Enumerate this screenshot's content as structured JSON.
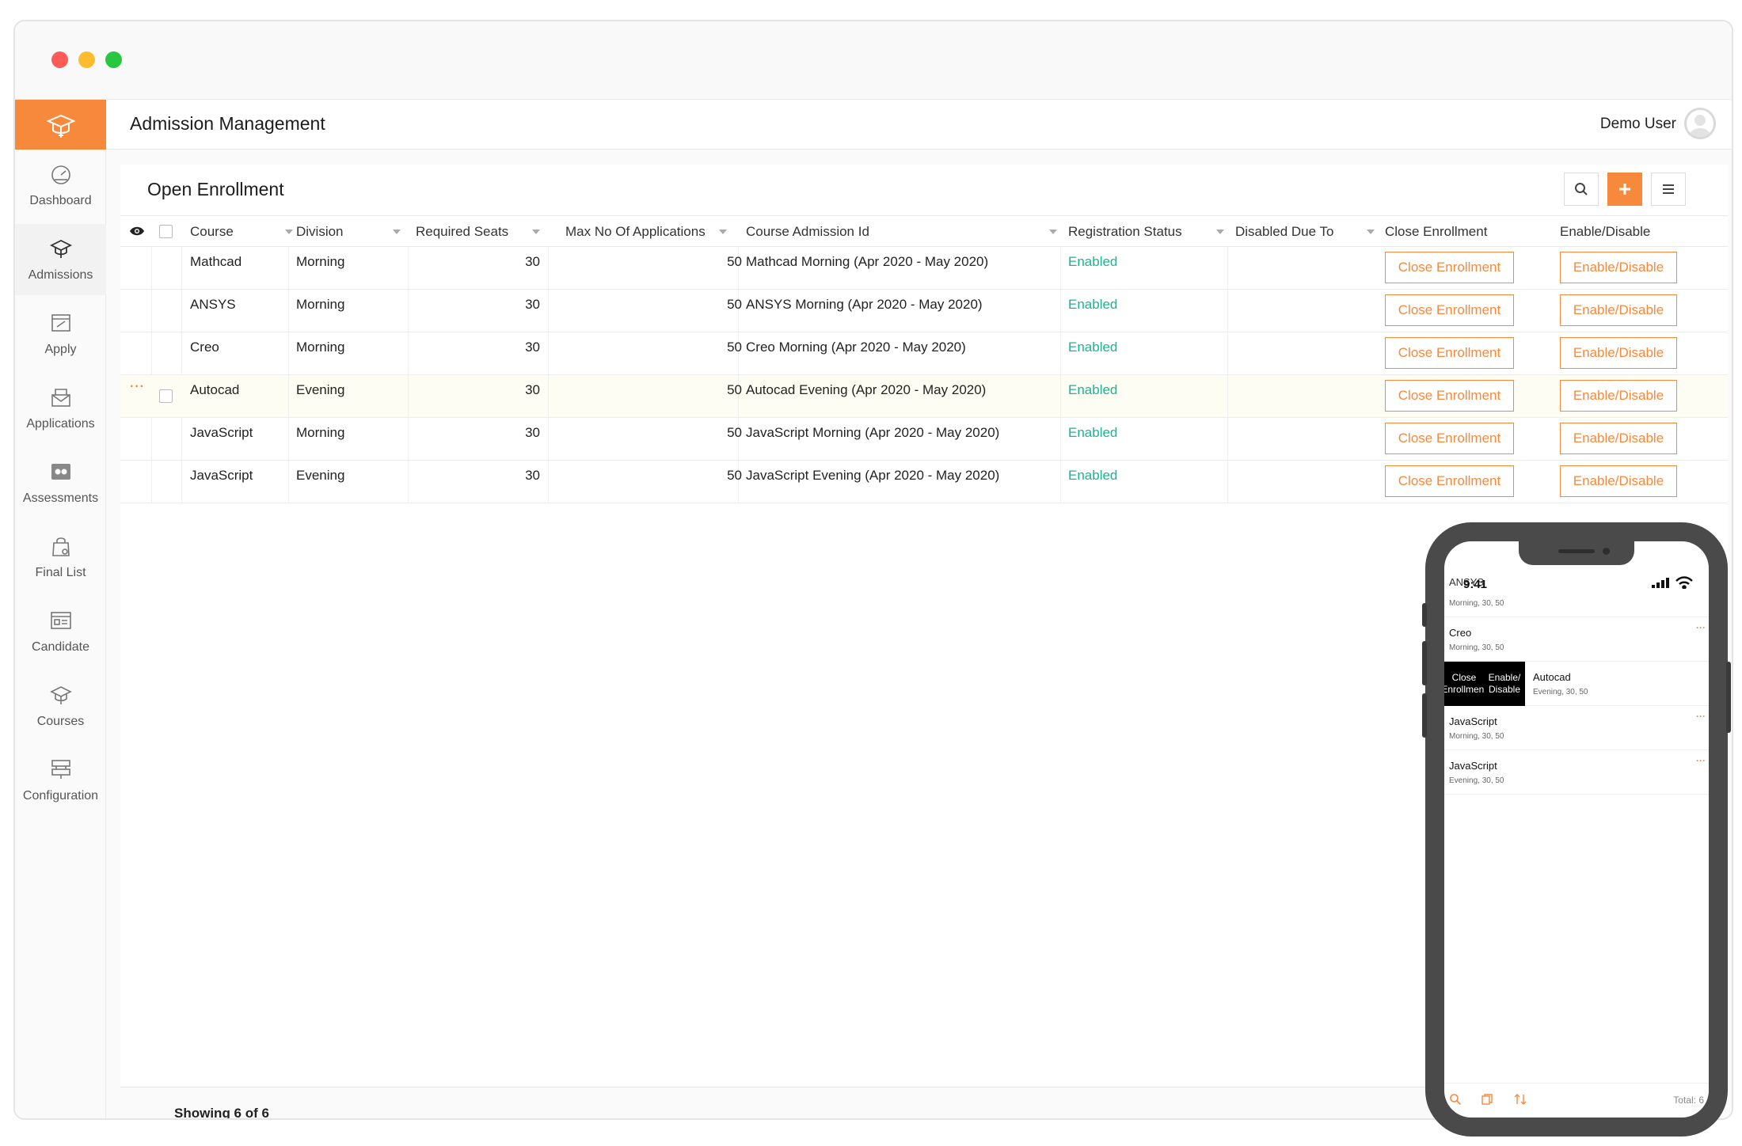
{
  "app": {
    "title": "Admission Management",
    "user_name": "Demo User",
    "accent_color": "#f7893c",
    "status_color": "#1ab394"
  },
  "sidebar": {
    "items": [
      {
        "label": "Dashboard",
        "icon": "speedometer-icon",
        "active": false
      },
      {
        "label": "Admissions",
        "icon": "graduation-cap-icon",
        "active": true
      },
      {
        "label": "Apply",
        "icon": "edit-form-icon",
        "active": false
      },
      {
        "label": "Applications",
        "icon": "mail-stack-icon",
        "active": false
      },
      {
        "label": "Assessments",
        "icon": "assessment-icon",
        "active": false
      },
      {
        "label": "Final List",
        "icon": "shopping-bag-icon",
        "active": false
      },
      {
        "label": "Candidate",
        "icon": "id-card-icon",
        "active": false
      },
      {
        "label": "Courses",
        "icon": "course-cap-icon",
        "active": false
      },
      {
        "label": "Configuration",
        "icon": "config-icon",
        "active": false
      }
    ]
  },
  "panel": {
    "title": "Open Enrollment",
    "toolbar": {
      "search_icon": "search-icon",
      "add_icon": "plus-icon",
      "menu_icon": "menu-icon"
    }
  },
  "table": {
    "columns": [
      "Course",
      "Division",
      "Required Seats",
      "Max No Of Applications",
      "Course Admission Id",
      "Registration Status",
      "Disabled Due To",
      "Close Enrollment",
      "Enable/Disable"
    ],
    "rows": [
      {
        "course": "Mathcad",
        "division": "Morning",
        "seats": "30",
        "max_apps": "50",
        "admission_id": "Mathcad Morning (Apr 2020 - May 2020)",
        "status": "Enabled",
        "disabled_due": "",
        "close_label": "Close Enrollment",
        "toggle_label": "Enable/Disable"
      },
      {
        "course": "ANSYS",
        "division": "Morning",
        "seats": "30",
        "max_apps": "50",
        "admission_id": "ANSYS Morning (Apr 2020 - May 2020)",
        "status": "Enabled",
        "disabled_due": "",
        "close_label": "Close Enrollment",
        "toggle_label": "Enable/Disable"
      },
      {
        "course": "Creo",
        "division": "Morning",
        "seats": "30",
        "max_apps": "50",
        "admission_id": "Creo Morning (Apr 2020 - May 2020)",
        "status": "Enabled",
        "disabled_due": "",
        "close_label": "Close Enrollment",
        "toggle_label": "Enable/Disable"
      },
      {
        "course": "Autocad",
        "division": "Evening",
        "seats": "30",
        "max_apps": "50",
        "admission_id": "Autocad Evening (Apr 2020 - May 2020)",
        "status": "Enabled",
        "disabled_due": "",
        "close_label": "Close Enrollment",
        "toggle_label": "Enable/Disable",
        "dots": "···"
      },
      {
        "course": "JavaScript",
        "division": "Morning",
        "seats": "30",
        "max_apps": "50",
        "admission_id": "JavaScript Morning (Apr 2020 - May 2020)",
        "status": "Enabled",
        "disabled_due": "",
        "close_label": "Close Enrollment",
        "toggle_label": "Enable/Disable"
      },
      {
        "course": "JavaScript",
        "division": "Evening",
        "seats": "30",
        "max_apps": "50",
        "admission_id": "JavaScript Evening (Apr 2020 - May 2020)",
        "status": "Enabled",
        "disabled_due": "",
        "close_label": "Close Enrollment",
        "toggle_label": "Enable/Disable"
      }
    ],
    "footer": "Showing 6 of 6"
  },
  "phone": {
    "time": "9:41",
    "peek_text": "ANSYS",
    "items": [
      {
        "name": "ANSYS",
        "sub": "Morning, 30, 50"
      },
      {
        "name": "Creo",
        "sub": "Morning, 30, 50",
        "dots": "···"
      },
      {
        "name": "Autocad",
        "sub": "Evening, 30, 50",
        "swiped": true,
        "action1": "Close Enrollment",
        "action2": "Enable/ Disable"
      },
      {
        "name": "JavaScript",
        "sub": "Morning, 30, 50",
        "dots": "···"
      },
      {
        "name": "JavaScript",
        "sub": "Evening, 30, 50",
        "dots": "···"
      }
    ],
    "total": "Total: 6"
  }
}
